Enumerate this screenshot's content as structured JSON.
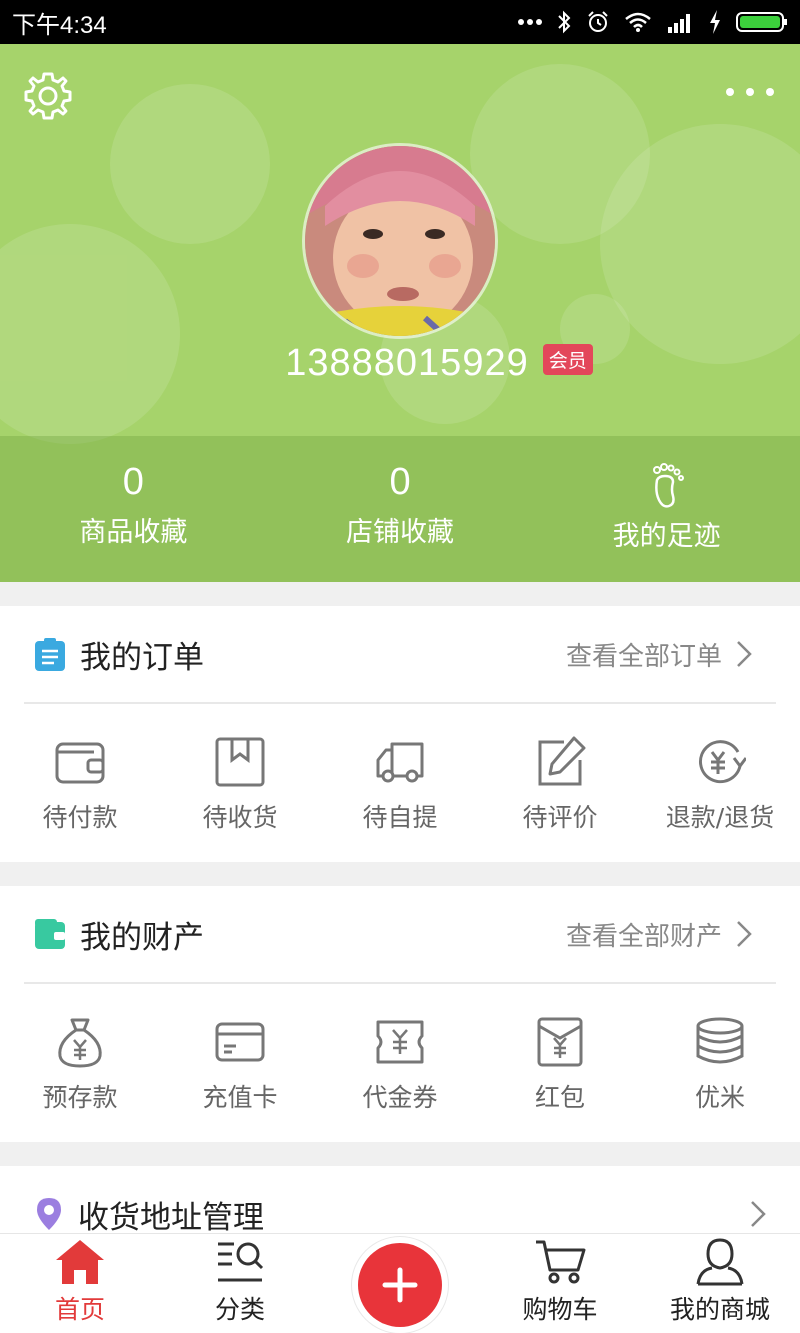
{
  "status_bar": {
    "time": "下午4:34"
  },
  "profile": {
    "phone": "13888015929",
    "badge": "会员"
  },
  "stats": [
    {
      "value": "0",
      "label": "商品收藏"
    },
    {
      "value": "0",
      "label": "店铺收藏"
    },
    {
      "label": "我的足迹"
    }
  ],
  "orders": {
    "title": "我的订单",
    "link": "查看全部订单",
    "items": [
      "待付款",
      "待收货",
      "待自提",
      "待评价",
      "退款/退货"
    ]
  },
  "assets": {
    "title": "我的财产",
    "link": "查看全部财产",
    "items": [
      "预存款",
      "充值卡",
      "代金券",
      "红包",
      "优米"
    ]
  },
  "address": {
    "title": "收货地址管理"
  },
  "bottom_nav": [
    "首页",
    "分类",
    "购物车",
    "我的商城"
  ],
  "colors": {
    "header_green": "#a6d36b",
    "accent_red": "#e23a3a",
    "vip_badge": "#e3475a"
  }
}
